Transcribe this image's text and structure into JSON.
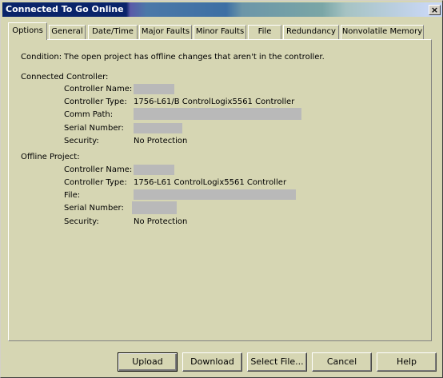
{
  "window": {
    "title": "Connected To Go Online",
    "close": "×"
  },
  "tabs": [
    "Options",
    "General",
    "Date/Time",
    "Major Faults",
    "Minor Faults",
    "File",
    "Redundancy",
    "Nonvolatile Memory"
  ],
  "condition": {
    "label": "Condition:",
    "text": "The open project has offline changes that aren't in the controller."
  },
  "connected": {
    "heading": "Connected Controller:",
    "name_label": "Controller Name:",
    "type_label": "Controller Type:",
    "type_value": "1756-L61/B ControlLogix5561 Controller",
    "comm_label": "Comm Path:",
    "serial_label": "Serial Number:",
    "security_label": "Security:",
    "security_value": "No Protection"
  },
  "offline": {
    "heading": "Offline Project:",
    "name_label": "Controller Name:",
    "type_label": "Controller Type:",
    "type_value": "1756-L61 ControlLogix5561 Controller",
    "file_label": "File:",
    "serial_label": "Serial Number:",
    "security_label": "Security:",
    "security_value": "No Protection"
  },
  "buttons": {
    "upload": "Upload",
    "download": "Download",
    "select_file": "Select File...",
    "cancel": "Cancel",
    "help": "Help"
  }
}
